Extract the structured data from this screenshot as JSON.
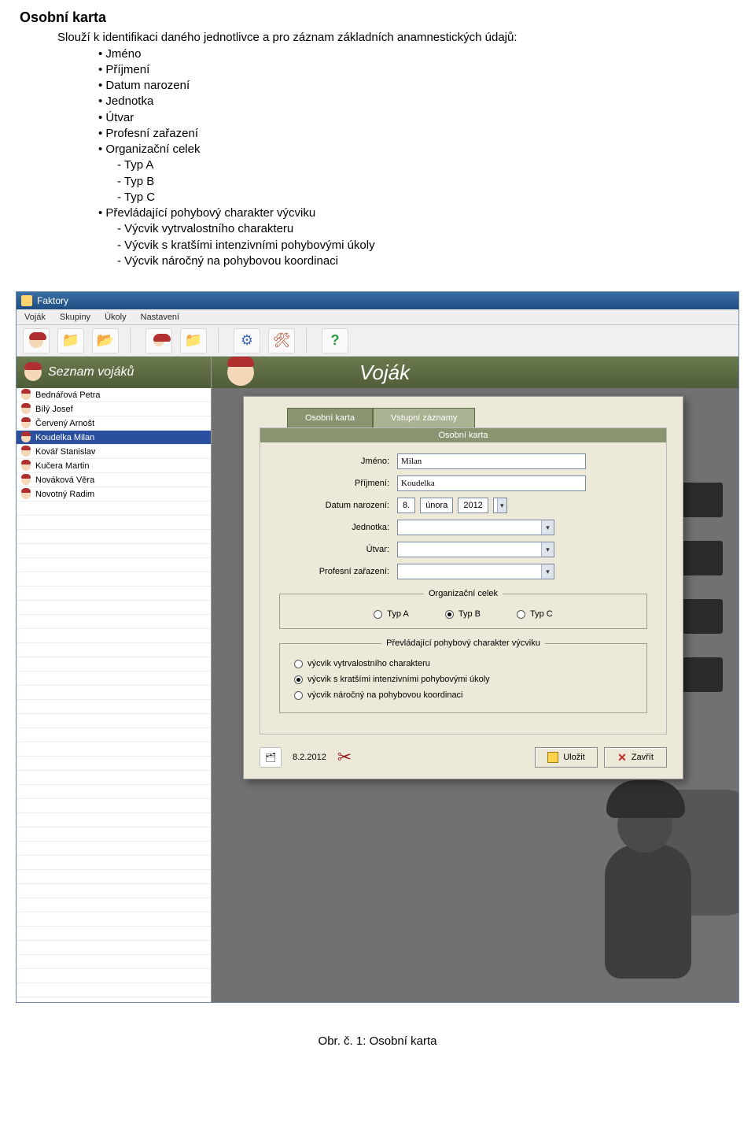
{
  "doc": {
    "heading": "Osobní karta",
    "intro": "Slouží k identifikaci daného jednotlivce a pro záznam základních anamnestických údajů:",
    "bullets": [
      "Jméno",
      "Příjmení",
      "Datum narození",
      "Jednotka",
      "Útvar",
      "Profesní zařazení",
      "Organizační celek"
    ],
    "sub_org": [
      "Typ A",
      "Typ B",
      "Typ C"
    ],
    "bullet_movement": "Převládající pohybový charakter výcviku",
    "sub_mov": [
      "Výcvik vytrvalostního charakteru",
      "Výcvik s kratšími intenzivními pohybovými úkoly",
      "Výcvik náročný na pohybovou koordinaci"
    ],
    "figure_caption": "Obr. č. 1: Osobní karta"
  },
  "app": {
    "window_title": "Faktory",
    "menu": {
      "vojak": "Voják",
      "skupiny": "Skupiny",
      "ukoly": "Úkoly",
      "nastaveni": "Nastavení"
    },
    "sidebar_title": "Seznam vojáků",
    "panel_title": "Voják",
    "soldiers": [
      "Bednářová Petra",
      "Bílý Josef",
      "Červený Arnošt",
      "Koudelka Milan",
      "Kovář Stanislav",
      "Kučera Martin",
      "Nováková Věra",
      "Novotný Radim"
    ],
    "selected_index": 3,
    "tabs": {
      "personal": "Osobní karta",
      "entry": "Vstupní záznamy"
    },
    "form": {
      "section_title": "Osobní karta",
      "labels": {
        "jmeno": "Jméno:",
        "prijmeni": "Příjmení:",
        "dob": "Datum narození:",
        "jednotka": "Jednotka:",
        "utvar": "Útvar:",
        "prof": "Profesní zařazení:"
      },
      "values": {
        "jmeno": "Milan",
        "prijmeni": "Koudelka",
        "dob_day": "8.",
        "dob_month": "února",
        "dob_year": "2012",
        "jednotka": "",
        "utvar": "",
        "prof": ""
      },
      "group_org": {
        "legend": "Organizační celek",
        "opts": {
          "a": "Typ A",
          "b": "Typ B",
          "c": "Typ C"
        },
        "selected": "b"
      },
      "group_mov": {
        "legend": "Převládající pohybový charakter výcviku",
        "opts": {
          "o1": "výcvik vytrvalostního charakteru",
          "o2": "výcvik s kratšími intenzivními pohybovými úkoly",
          "o3": "výcvik náročný na pohybovou koordinaci"
        },
        "selected": "o2"
      },
      "footer_date": "8.2.2012",
      "save": "Uložit",
      "close": "Zavřít"
    }
  }
}
